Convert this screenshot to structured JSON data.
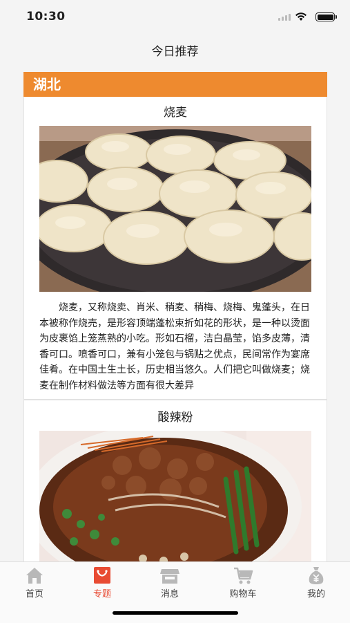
{
  "status_bar": {
    "time": "10:30"
  },
  "nav": {
    "title": "今日推荐"
  },
  "region": {
    "name": "湖北"
  },
  "dishes": [
    {
      "name": "烧麦",
      "description": "烧麦，又称烧卖、肖米、稍麦、稍梅、烧梅、鬼蓬头，在日本被称作烧売，是形容顶端蓬松束折如花的形状，是一种以烫面为皮裹馅上笼蒸熟的小吃。形如石榴，洁白晶莹，馅多皮薄，清香可口。喷香可口，兼有小笼包与锅贴之优点，民间常作为宴席佳肴。在中国土生土长，历史相当悠久。人们把它叫做烧麦；烧麦在制作材料做法等方面有很大差异"
    },
    {
      "name": "酸辣粉"
    }
  ],
  "tabbar": {
    "items": [
      {
        "label": "首页",
        "icon": "home-icon"
      },
      {
        "label": "专题",
        "icon": "shopping-bag-icon"
      },
      {
        "label": "消息",
        "icon": "store-icon"
      },
      {
        "label": "购物车",
        "icon": "cart-icon"
      },
      {
        "label": "我的",
        "icon": "money-bag-icon"
      }
    ],
    "active_color": "#e84b33",
    "inactive_color": "#b8b8b8"
  },
  "colors": {
    "region_bar": "#ee8a2f"
  }
}
